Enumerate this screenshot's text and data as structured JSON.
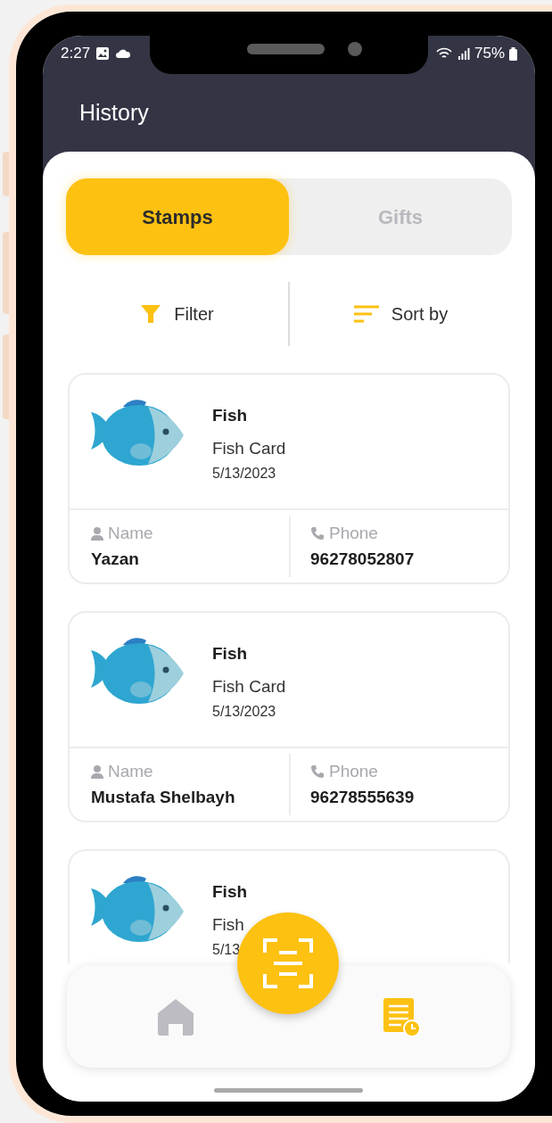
{
  "status_bar": {
    "time": "2:27",
    "battery": "75%"
  },
  "header": {
    "title": "History"
  },
  "tabs": [
    {
      "label": "Stamps",
      "selected": true
    },
    {
      "label": "Gifts",
      "selected": false
    }
  ],
  "actions": [
    {
      "label": "Filter",
      "kind": "filter"
    },
    {
      "label": "Sort by",
      "kind": "sort"
    }
  ],
  "cards": [
    {
      "title": "Fish",
      "subtitle": "Fish Card",
      "date": "5/13/2023",
      "name_label": "Name",
      "name": "Yazan",
      "phone_label": "Phone",
      "phone": "96278052807"
    },
    {
      "title": "Fish",
      "subtitle": "Fish Card",
      "date": "5/13/2023",
      "name_label": "Name",
      "name": "Mustafa Shelbayh",
      "phone_label": "Phone",
      "phone": "96278555639"
    },
    {
      "title": "Fish",
      "subtitle": "Fish",
      "date": "5/13"
    }
  ],
  "bottom_nav": [
    {
      "kind": "home",
      "selected": false
    },
    {
      "kind": "history",
      "selected": true
    }
  ]
}
